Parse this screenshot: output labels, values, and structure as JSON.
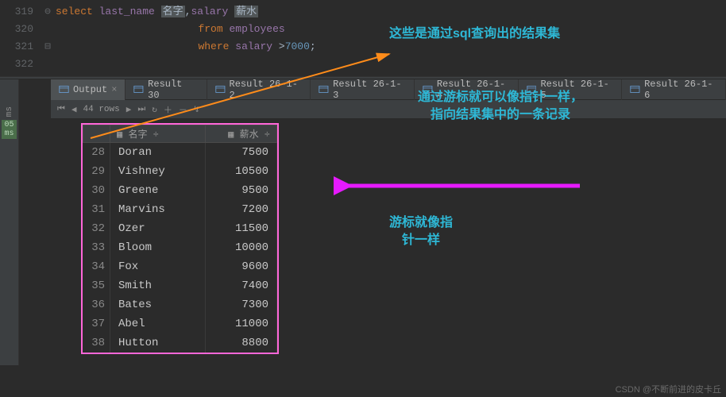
{
  "gutter": [
    "319",
    "320",
    "321",
    "322"
  ],
  "sql": {
    "select_kw": "select",
    "col1": "last_name",
    "alias1": "名字",
    "col2": "salary",
    "alias2": "薪水",
    "from_kw": "from",
    "table": "employees",
    "where_kw": "where",
    "where_col": "salary",
    "op": ">",
    "val": "7000",
    "semi": ";"
  },
  "tabs": [
    {
      "label": "Output",
      "active": true
    },
    {
      "label": "Result 30"
    },
    {
      "label": "Result 26-1-2"
    },
    {
      "label": "Result 26-1-3"
    },
    {
      "label": "Result 26-1-4"
    },
    {
      "label": "Result 26-1-5"
    },
    {
      "label": "Result 26-1-6"
    }
  ],
  "toolbar": {
    "rows": "44 rows"
  },
  "headers": {
    "rn": "",
    "name": "名字",
    "salary": "薪水"
  },
  "rows": [
    {
      "n": "28",
      "name": "Doran",
      "sal": "7500"
    },
    {
      "n": "29",
      "name": "Vishney",
      "sal": "10500"
    },
    {
      "n": "30",
      "name": "Greene",
      "sal": "9500"
    },
    {
      "n": "31",
      "name": "Marvins",
      "sal": "7200"
    },
    {
      "n": "32",
      "name": "Ozer",
      "sal": "11500"
    },
    {
      "n": "33",
      "name": "Bloom",
      "sal": "10000"
    },
    {
      "n": "34",
      "name": "Fox",
      "sal": "9600"
    },
    {
      "n": "35",
      "name": "Smith",
      "sal": "7400"
    },
    {
      "n": "36",
      "name": "Bates",
      "sal": "7300"
    },
    {
      "n": "37",
      "name": "Abel",
      "sal": "11000"
    },
    {
      "n": "38",
      "name": "Hutton",
      "sal": "8800"
    }
  ],
  "anno": {
    "a1": "这些是通过sql查询出的结果集",
    "a2": "通过游标就可以像指针一样，指向结果集中的一条记录",
    "a3": "游标就像指\n针一样"
  },
  "side": {
    "ms": "ms",
    "t": "05 ms"
  },
  "watermark": "CSDN @不断前进的皮卡丘"
}
